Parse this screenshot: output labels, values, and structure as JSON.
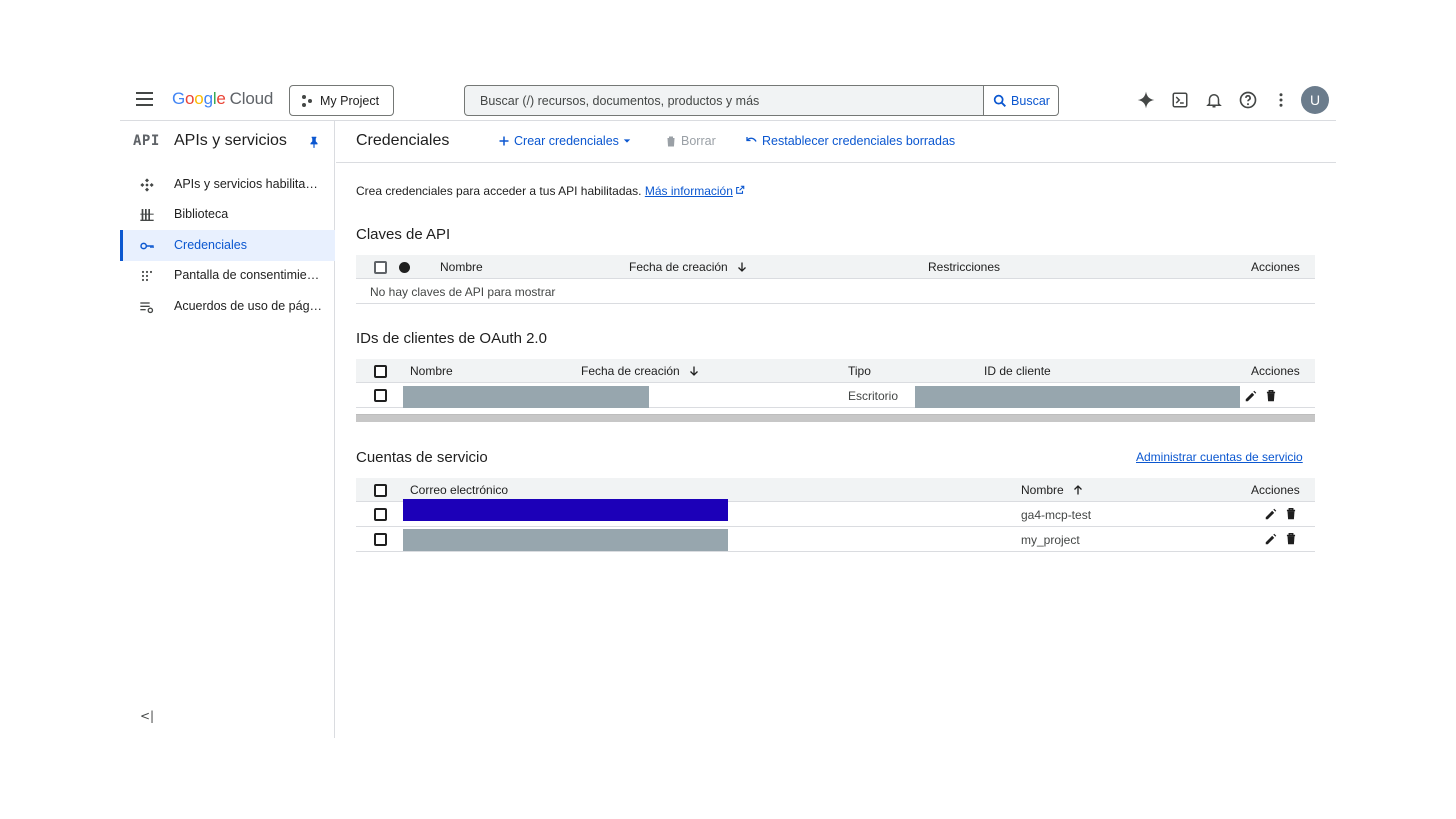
{
  "header": {
    "logo": {
      "brand": "Google",
      "product": "Cloud"
    },
    "project_button": "My Project",
    "search": {
      "placeholder": "Buscar (/) recursos, documentos, productos y más",
      "button_label": "Buscar"
    },
    "avatar_initial": "U",
    "icons": [
      "menu-icon",
      "sparkle-icon",
      "terminal-icon",
      "bell-icon",
      "help-icon",
      "more-vert-icon"
    ]
  },
  "sidebar": {
    "logo_text": "API",
    "title": "APIs y servicios",
    "items": [
      {
        "label": "APIs y servicios habilitados",
        "icon": "hub-icon",
        "active": false
      },
      {
        "label": "Biblioteca",
        "icon": "library-icon",
        "active": false
      },
      {
        "label": "Credenciales",
        "icon": "key-icon",
        "active": true
      },
      {
        "label": "Pantalla de consentimiento de OAuth",
        "icon": "consent-icon",
        "active": false
      },
      {
        "label": "Acuerdos de uso de páginas",
        "icon": "settings-list-icon",
        "active": false
      }
    ],
    "collapse_glyph": "<|"
  },
  "main": {
    "title": "Credenciales",
    "actions": {
      "create": "Crear credenciales",
      "delete": "Borrar",
      "restore": "Restablecer credenciales borradas"
    },
    "intro": {
      "text": "Crea credenciales para acceder a tus API habilitadas.",
      "link": "Más información"
    },
    "api_keys": {
      "title": "Claves de API",
      "columns": [
        "Nombre",
        "Fecha de creación",
        "Restricciones",
        "Acciones"
      ],
      "empty": "No hay claves de API para mostrar"
    },
    "oauth": {
      "title": "IDs de clientes de OAuth 2.0",
      "columns": [
        "Nombre",
        "Fecha de creación",
        "Tipo",
        "ID de cliente",
        "Acciones"
      ],
      "rows": [
        {
          "type": "Escritorio"
        }
      ]
    },
    "service_accounts": {
      "title": "Cuentas de servicio",
      "manage_link": "Administrar cuentas de servicio",
      "columns": [
        "Correo electrónico",
        "Nombre",
        "Acciones"
      ],
      "rows": [
        {
          "name": "ga4-mcp-test"
        },
        {
          "name": "my_project"
        }
      ]
    }
  },
  "colors": {
    "accent": "#0b57d0",
    "active_bg": "#e8f0fe",
    "redacted": "#97a6ae",
    "redacted_blue": "#1c00b8"
  }
}
